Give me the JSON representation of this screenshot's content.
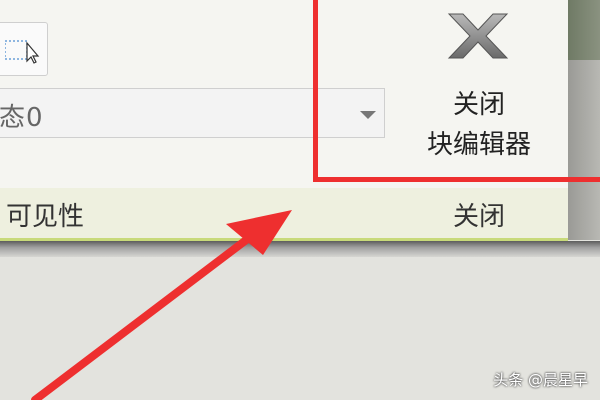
{
  "ribbon": {
    "visibility_state_value": "态0",
    "close_button": {
      "line1": "关闭",
      "line2": "块编辑器"
    },
    "group_labels": {
      "visibility": "可见性",
      "close": "关闭"
    }
  },
  "watermark": "头条 @晨星早",
  "icons": {
    "tool": "pointer-cursor-icon",
    "close": "close-x-icon",
    "dropdown": "chevron-down-icon"
  },
  "colors": {
    "annotation": "#ee2f2f",
    "group_bar": "#eef0df",
    "group_border": "#c8da7a"
  }
}
